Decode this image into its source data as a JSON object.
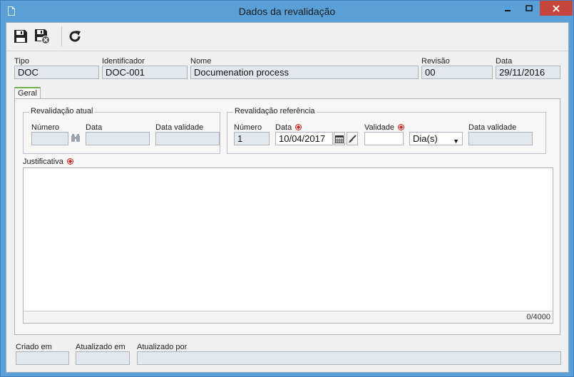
{
  "window": {
    "title": "Dados da revalidação"
  },
  "header": {
    "tipo": {
      "label": "Tipo",
      "value": "DOC"
    },
    "identificador": {
      "label": "Identificador",
      "value": "DOC-001"
    },
    "nome": {
      "label": "Nome",
      "value": "Documenation process"
    },
    "revisao": {
      "label": "Revisão",
      "value": "00"
    },
    "data": {
      "label": "Data",
      "value": "29/11/2016"
    }
  },
  "tabs": [
    {
      "label": "Geral"
    }
  ],
  "revalidacao_atual": {
    "title": "Revalidação atual",
    "numero": {
      "label": "Número",
      "value": ""
    },
    "data": {
      "label": "Data",
      "value": ""
    },
    "data_validade": {
      "label": "Data validade",
      "value": ""
    }
  },
  "revalidacao_referencia": {
    "title": "Revalidação referência",
    "numero": {
      "label": "Número",
      "value": "1"
    },
    "data": {
      "label": "Data",
      "value": "10/04/2017"
    },
    "validade": {
      "label": "Validade",
      "value": ""
    },
    "unidade": {
      "selected": "Dia(s)"
    },
    "data_validade": {
      "label": "Data validade",
      "value": ""
    }
  },
  "justificativa": {
    "label": "Justificativa",
    "value": "",
    "counter": "0/4000"
  },
  "footer": {
    "criado_em": {
      "label": "Criado em",
      "value": ""
    },
    "atualizado_em": {
      "label": "Atualizado em",
      "value": ""
    },
    "atualizado_por": {
      "label": "Atualizado por",
      "value": ""
    }
  },
  "colors": {
    "titlebar": "#5aa0d8",
    "close": "#c7463b",
    "required": "#d02020",
    "tab_accent": "#6fb050"
  }
}
